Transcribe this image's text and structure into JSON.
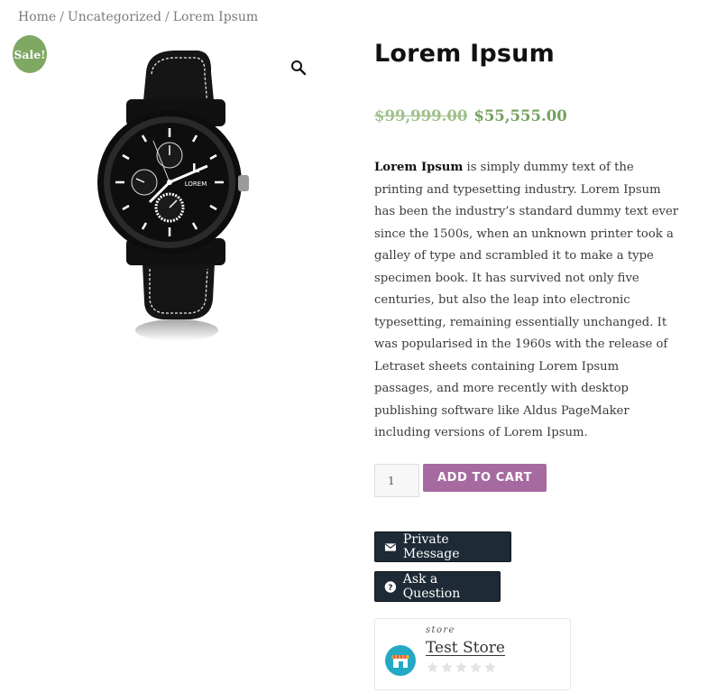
{
  "breadcrumb": {
    "home": "Home",
    "separator": "/",
    "category": "Uncategorized",
    "current": "Lorem Ipsum"
  },
  "badge": {
    "label": "Sale!",
    "color": "#7fa863"
  },
  "product": {
    "title": "Lorem Ipsum",
    "regular_price": "$99,999.00",
    "sale_price": "$55,555.00",
    "description_bold": "Lorem Ipsum",
    "description_rest": " is simply dummy text of the printing and typesetting industry. Lorem Ipsum has been the industry’s standard dummy text ever since the 1500s, when an unknown printer took a galley of type and scrambled it to make a type specimen book. It has survived not only five centuries, but also the leap into electronic typesetting, remaining essentially unchanged. It was popularised in the 1960s with the release of Letraset sheets containing Lorem Ipsum passages, and more recently with desktop publishing software like Aldus PageMaker including versions of Lorem Ipsum.",
    "image_icon": "wristwatch-image",
    "watch_brand_text": "LOREM"
  },
  "cart": {
    "quantity": "1",
    "add_label": "ADD TO CART",
    "accent": "#a66aa0"
  },
  "vendor_actions": {
    "private_message": {
      "label": "Private Message",
      "icon": "envelope-icon"
    },
    "ask_question": {
      "label": "Ask a Question",
      "icon": "question-circle-icon"
    }
  },
  "store": {
    "caption": "store",
    "name": "Test Store",
    "rating": 0,
    "rating_max": 5,
    "icon": "store-icon"
  },
  "icons": {
    "zoom": "magnifier-icon"
  }
}
